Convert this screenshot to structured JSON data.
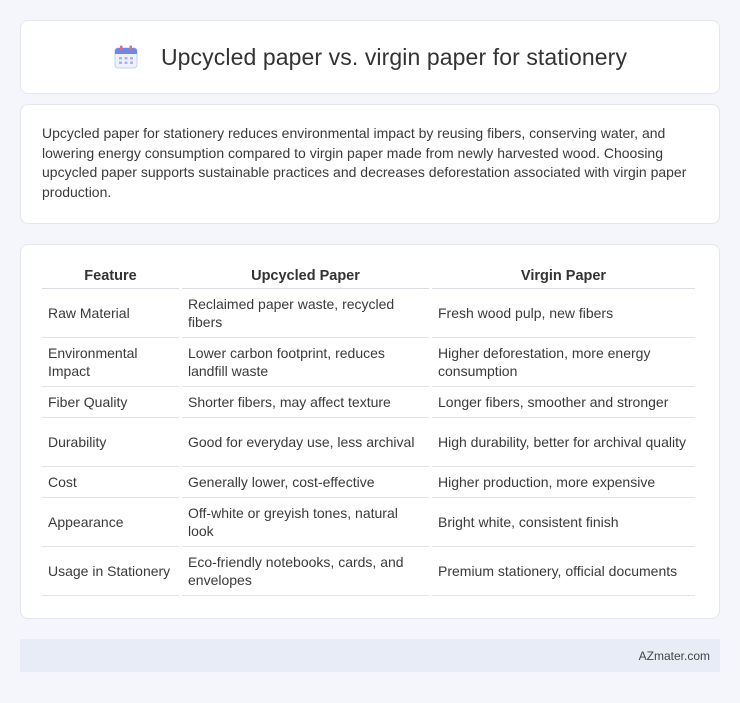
{
  "title": "Upcycled paper vs. virgin paper for stationery",
  "intro": "Upcycled paper for stationery reduces environmental impact by reusing fibers, conserving water, and lowering energy consumption compared to virgin paper made from newly harvested wood. Choosing upcycled paper supports sustainable practices and decreases deforestation associated with virgin paper production.",
  "table": {
    "headers": [
      "Feature",
      "Upcycled Paper",
      "Virgin Paper"
    ],
    "rows": [
      [
        "Raw Material",
        "Reclaimed paper waste, recycled fibers",
        "Fresh wood pulp, new fibers"
      ],
      [
        "Environmental Impact",
        "Lower carbon footprint, reduces landfill waste",
        "Higher deforestation, more energy consumption"
      ],
      [
        "Fiber Quality",
        "Shorter fibers, may affect texture",
        "Longer fibers, smoother and stronger"
      ],
      [
        "Durability",
        "Good for everyday use, less archival",
        "High durability, better for archival quality"
      ],
      [
        "Cost",
        "Generally lower, cost-effective",
        "Higher production, more expensive"
      ],
      [
        "Appearance",
        "Off-white or greyish tones, natural look",
        "Bright white, consistent finish"
      ],
      [
        "Usage in Stationery",
        "Eco-friendly notebooks, cards, and envelopes",
        "Premium stationery, official documents"
      ]
    ]
  },
  "footer": "AZmater.com",
  "icon": "calendar-icon"
}
